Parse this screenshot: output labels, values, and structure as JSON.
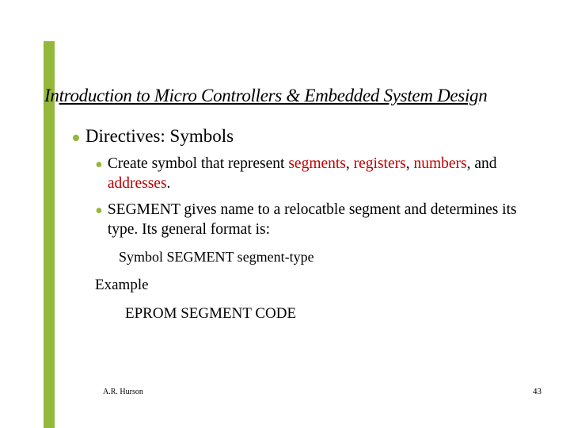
{
  "title": {
    "full": "Introduction to Micro Controllers & Embedded System Design",
    "part1": "In",
    "part2": "troduction to Micro Controllers & Embedded System Desig",
    "part3": "n"
  },
  "main": {
    "heading": "Directives: Symbols",
    "items": [
      {
        "text_a": "Create symbol that represent ",
        "red1": "segments",
        "sep1": ", ",
        "red2": "registers",
        "sep2": ", ",
        "red3": "numbers",
        "sep3": ", and ",
        "red4": "addresses",
        "tail": "."
      },
      {
        "text": "SEGMENT gives name to a relocatble segment and determines its type.  Its general format is:"
      }
    ],
    "syntax": "Symbol    SEGMENT   segment-type",
    "example_label": "Example",
    "example_code": "EPROM    SEGMENT   CODE"
  },
  "footer": {
    "left": "A.R. Hurson",
    "right": "43"
  }
}
